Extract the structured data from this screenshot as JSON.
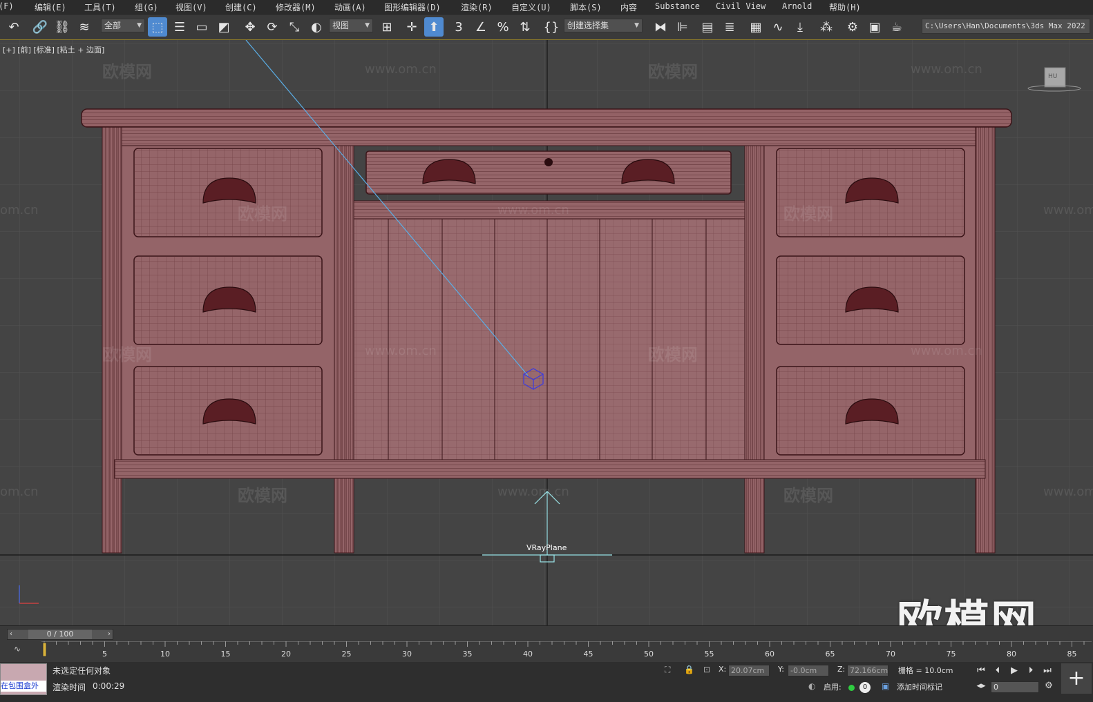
{
  "menubar": {
    "items": [
      "(F)",
      "编辑(E)",
      "工具(T)",
      "组(G)",
      "视图(V)",
      "创建(C)",
      "修改器(M)",
      "动画(A)",
      "图形编辑器(D)",
      "渲染(R)",
      "自定义(U)",
      "脚本(S)",
      "内容",
      "Substance",
      "Civil View",
      "Arnold",
      "帮助(H)"
    ]
  },
  "toolbar": {
    "selection_filter": "全部",
    "ref_coord": "视图",
    "named_selection": "创建选择集",
    "project_path": "C:\\Users\\Han\\Documents\\3ds Max 2022"
  },
  "viewport": {
    "label": "[+] [前] [标准] [粘土 + 边面]",
    "object_label": "VRayPlane",
    "cube_label": "HU",
    "brand": "欧模网",
    "watermark_cn": "欧模网",
    "watermark_url": "www.om.cn",
    "watermark_url_short": "om.cn"
  },
  "timeline": {
    "frame_display": "0 / 100",
    "ticks": [
      "5",
      "10",
      "15",
      "20",
      "25",
      "30",
      "35",
      "40",
      "45",
      "50",
      "55",
      "60",
      "65",
      "70",
      "75",
      "80",
      "85"
    ]
  },
  "status": {
    "maxscript_text": "在包围盒外",
    "selection_status": "未选定任何对象",
    "render_time_label": "渲染时间",
    "render_time_value": "0:00:29",
    "x_label": "X:",
    "x_value": "20.07cm",
    "y_label": "Y:",
    "y_value": "-0.0cm",
    "z_label": "Z:",
    "z_value": "72.166cm",
    "grid_text": "栅格 = 10.0cm",
    "enable_label": "启用:",
    "enable_count": "0",
    "add_time_tag": "添加时间标记",
    "current_frame": "0"
  },
  "colors": {
    "model_fill": "#946468",
    "wire": "#3a1418",
    "menubar_bg": "#2b2b2b",
    "toolbar_bg": "#3a3a3a",
    "viewport_bg": "#444444",
    "active_tool": "#4f8ad0",
    "highlight": "#8c7a2a"
  },
  "icons": [
    "undo-icon",
    "link-icon",
    "unlink-icon",
    "bind-spacewarp-icon",
    "select-object-icon",
    "select-by-name-icon",
    "rect-region-icon",
    "window-crossing-icon",
    "move-icon",
    "rotate-icon",
    "scale-icon",
    "select-manipulate-icon",
    "use-pivot-icon",
    "snap-toggle-icon",
    "angle-snap-icon",
    "percent-snap-icon",
    "spinner-snap-icon",
    "edit-named-sets-icon",
    "mirror-icon",
    "align-icon",
    "scene-explorer-icon",
    "layer-explorer-icon",
    "toggle-ribbon-icon",
    "curve-editor-icon",
    "dope-sheet-icon",
    "schematic-view-icon",
    "render-setup-icon",
    "render-frame-icon",
    "render-production-icon"
  ]
}
